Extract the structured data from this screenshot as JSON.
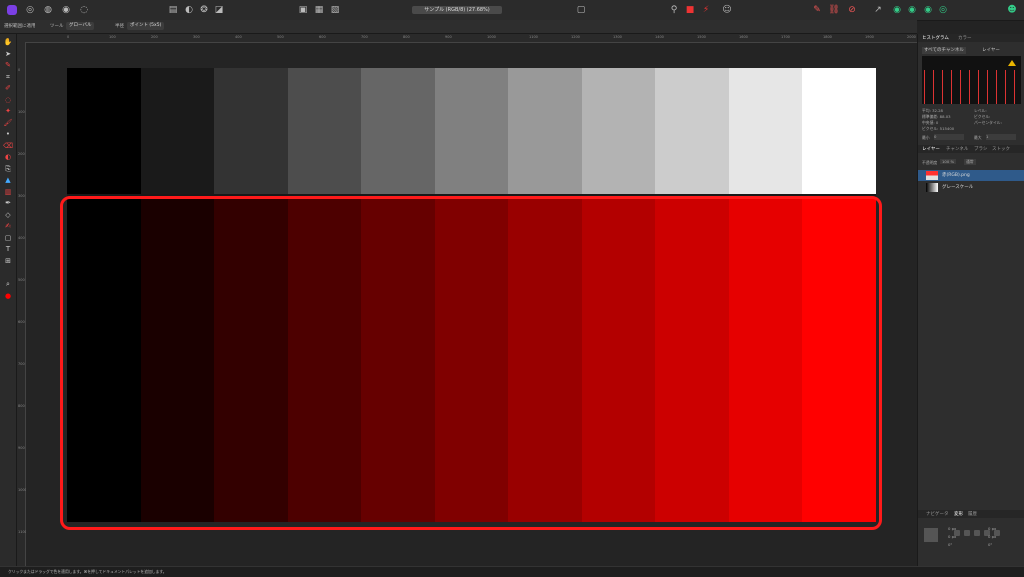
{
  "document_tab": "サンプル (RGB/8) (27.68%)",
  "context_bar": {
    "option1": "選択範囲に適用",
    "mode_label": "ツール",
    "mode_value": "グローバル",
    "size_label": "半径",
    "size_value": "ポイント (5x5)"
  },
  "ruler_top": [
    "0",
    "100",
    "200",
    "300",
    "400",
    "500",
    "600",
    "700",
    "800",
    "900",
    "1000",
    "1100",
    "1200",
    "1300",
    "1400",
    "1500",
    "1600",
    "1700",
    "1800",
    "1900",
    "2000"
  ],
  "ruler_left": [
    "0",
    "100",
    "200",
    "300",
    "400",
    "500",
    "600",
    "700",
    "800",
    "900",
    "1000",
    "1100",
    "1200"
  ],
  "swatches": {
    "gray": [
      "#000000",
      "#1a1a1a",
      "#333333",
      "#4d4d4d",
      "#666666",
      "#808080",
      "#999999",
      "#b3b3b3",
      "#cccccc",
      "#e6e6e6",
      "#ffffff"
    ],
    "red": [
      "#000000",
      "#1a0000",
      "#330000",
      "#4d0000",
      "#660000",
      "#800000",
      "#990000",
      "#b30000",
      "#cc0000",
      "#e60000",
      "#ff0000"
    ]
  },
  "highlight_color": "#ff1a1a",
  "tools": [
    "hand-icon",
    "move-icon",
    "brush-icon",
    "crop-icon",
    "picker-icon",
    "selection-brush-icon",
    "flood-select-icon",
    "paint-brush-icon",
    "pixel-icon",
    "erase-icon",
    "dodge-icon",
    "clone-icon",
    "fill-icon",
    "gradient-icon",
    "pen-icon",
    "node-icon",
    "vector-brush-icon",
    "shape-icon",
    "text-icon",
    "frame-text-icon",
    "zoom-icon",
    "color-picker-icon"
  ],
  "right_panel": {
    "tab_histogram": "ヒストグラム",
    "tab_color": "カラー",
    "channel_select": "すべてのチャンネル",
    "layer_checkbox": "レイヤー",
    "stats": {
      "avg": "平均: 32.28",
      "stddev": "標準偏差: 88.03",
      "median": "中央値: 0",
      "pixels": "ピクセル: 515400",
      "level": "レベル:",
      "count": "ピクセル:",
      "percentile": "パーセンタイル:"
    },
    "min_label": "最小",
    "min_value": "0",
    "max_label": "最大",
    "max_value": "1",
    "layer_tabs": [
      "レイヤー",
      "チャンネル",
      "ブラシ",
      "ストック"
    ],
    "opacity_label": "不透明度",
    "opacity_value": "100 %",
    "blend_mode": "通常",
    "layers": [
      {
        "name": "赤(RGB).png",
        "selected": true
      },
      {
        "name": "グレースケール",
        "selected": false
      }
    ],
    "bottom_tabs": [
      "ナビゲータ",
      "変形",
      "履歴"
    ],
    "transform": {
      "x": "0 px",
      "y": "0 px",
      "w": "0 px",
      "h": "0 px",
      "r": "0°",
      "s": "0°"
    }
  },
  "status_bar": "クリックまたはドラッグで色を適用します。⌘を押してドキュメントパレットを追加します。"
}
